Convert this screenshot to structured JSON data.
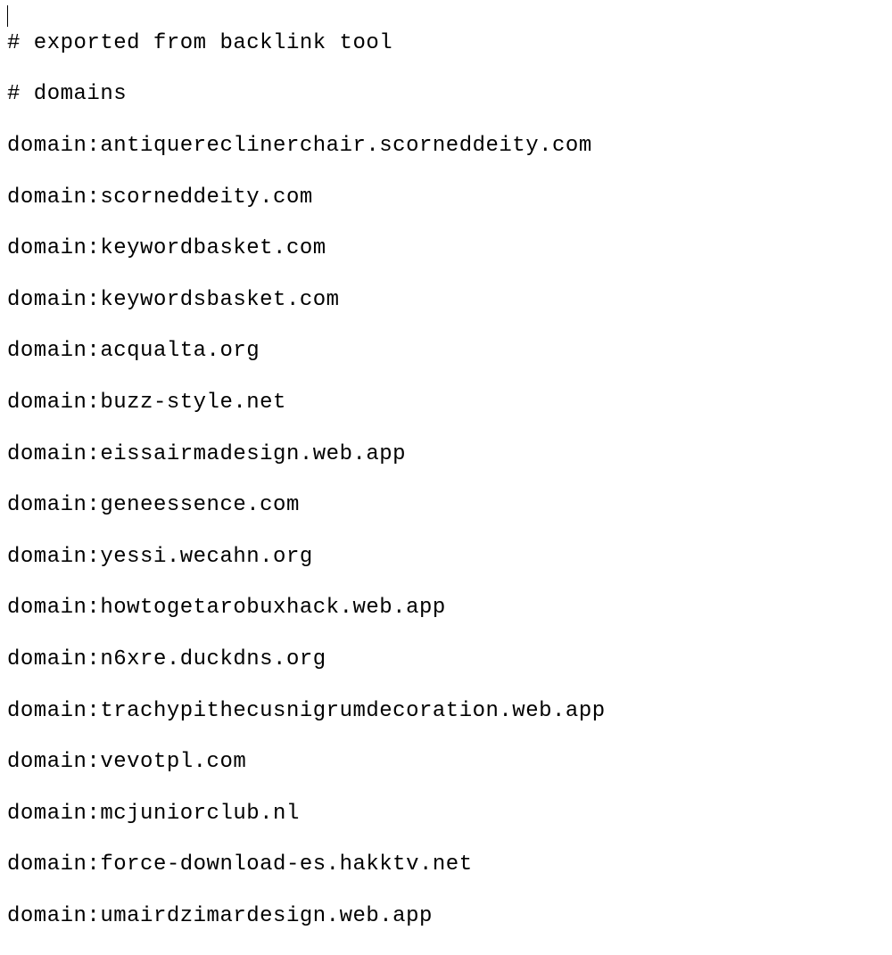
{
  "comments": [
    "# exported from backlink tool",
    "# domains"
  ],
  "prefix": "domain:",
  "domains": [
    "antiquereclinerchair.scorneddeity.com",
    "scorneddeity.com",
    "keywordbasket.com",
    "keywordsbasket.com",
    "acqualta.org",
    "buzz-style.net",
    "eissairmadesign.web.app",
    "geneessence.com",
    "yessi.wecahn.org",
    "howtogetarobuxhack.web.app",
    "n6xre.duckdns.org",
    "trachypithecusnigrumdecoration.web.app",
    "vevotpl.com",
    "mcjuniorclub.nl",
    "force-download-es.hakktv.net",
    "umairdzimardesign.web.app"
  ]
}
